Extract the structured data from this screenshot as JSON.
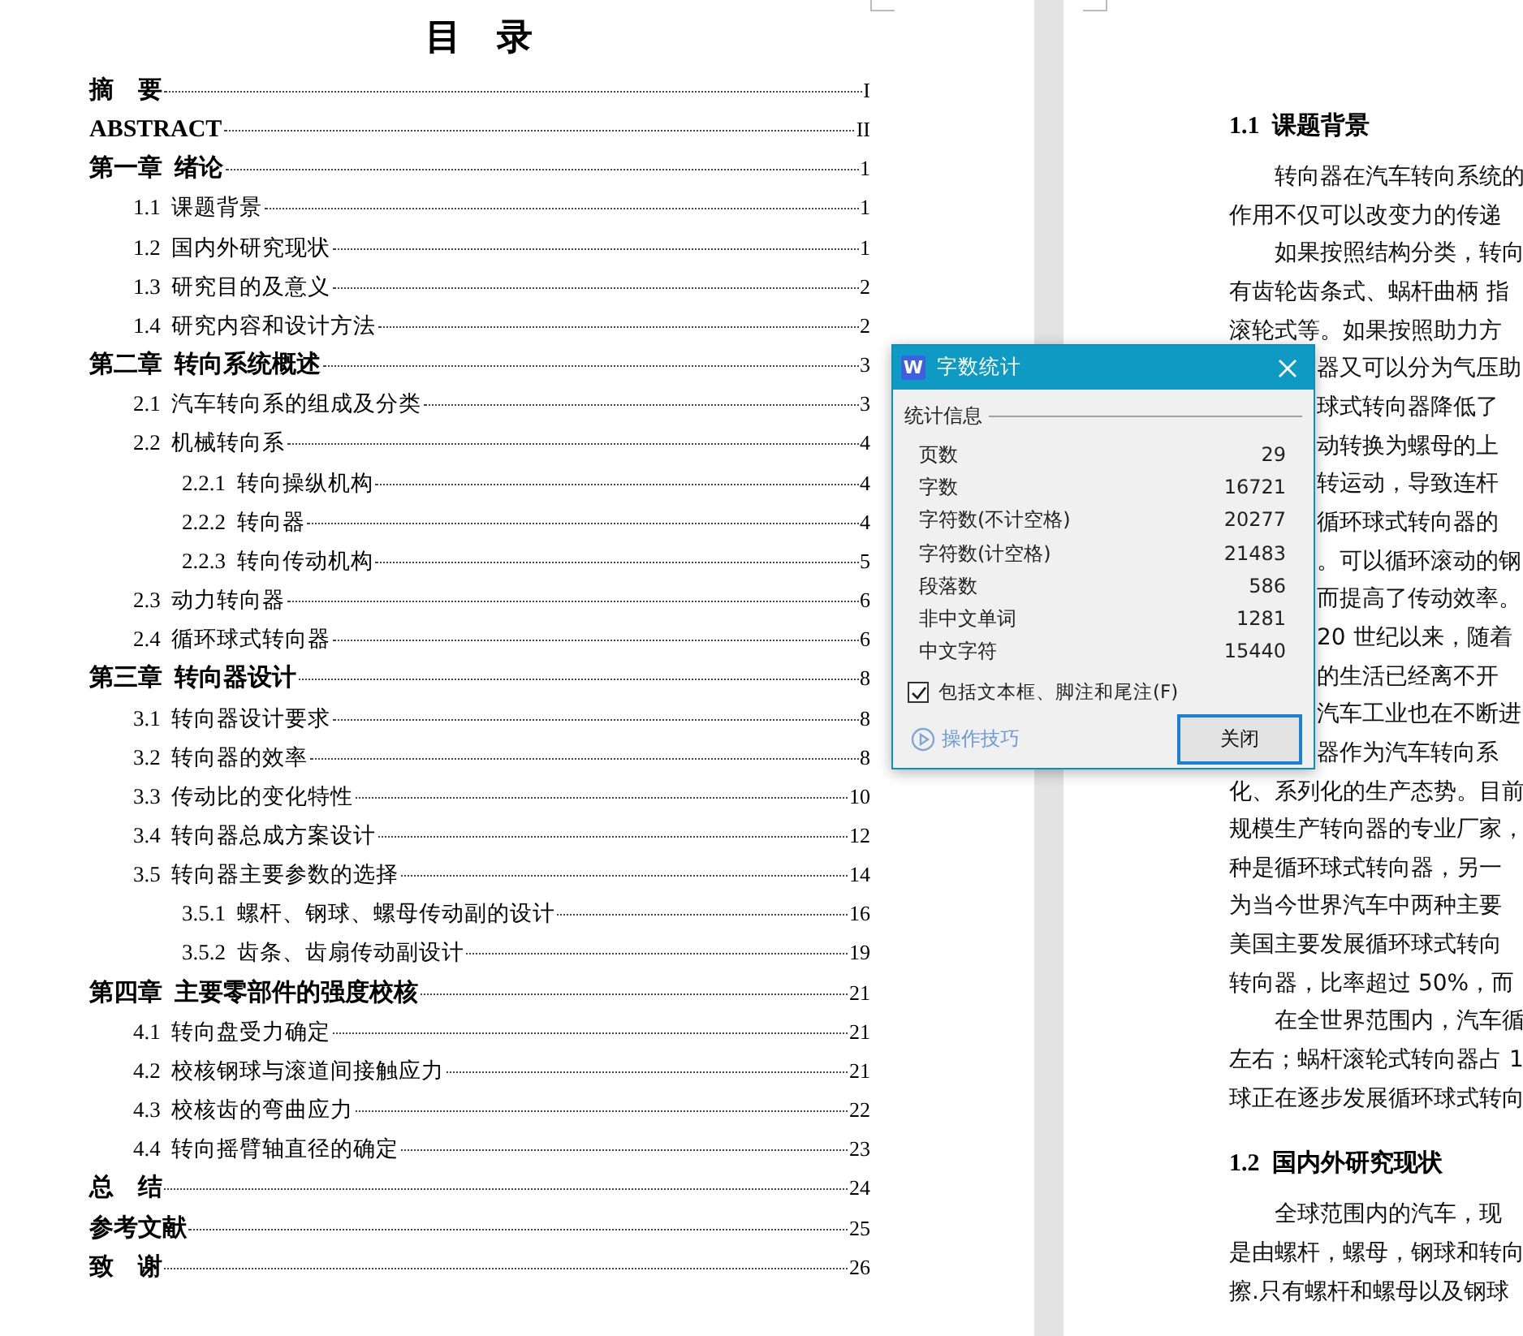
{
  "toc_page": {
    "title": "目　录",
    "entries": [
      {
        "kind": "chapter",
        "text": "摘　要",
        "page": "I"
      },
      {
        "kind": "chapter",
        "text": "ABSTRACT",
        "page": "II"
      },
      {
        "kind": "chapter",
        "text": "第一章  绪论",
        "page": "1",
        "children": [
          {
            "kind": "section",
            "text": "1.1  课题背景",
            "page": "1"
          },
          {
            "kind": "section",
            "text": "1.2  国内外研究现状",
            "page": "1"
          },
          {
            "kind": "section",
            "text": "1.3  研究目的及意义",
            "page": "2"
          },
          {
            "kind": "section",
            "text": "1.4  研究内容和设计方法",
            "page": "2"
          }
        ]
      },
      {
        "kind": "chapter",
        "text": "第二章  转向系统概述",
        "page": "3",
        "children": [
          {
            "kind": "section",
            "text": "2.1  汽车转向系的组成及分类",
            "page": "3"
          },
          {
            "kind": "section",
            "text": "2.2  机械转向系",
            "page": "4",
            "children": [
              {
                "kind": "section",
                "text": "2.2.1  转向操纵机构",
                "page": "4"
              },
              {
                "kind": "section",
                "text": "2.2.2  转向器",
                "page": "4"
              },
              {
                "kind": "section",
                "text": "2.2.3  转向传动机构",
                "page": "5"
              }
            ]
          },
          {
            "kind": "section",
            "text": "2.3  动力转向器",
            "page": "6"
          },
          {
            "kind": "section",
            "text": "2.4  循环球式转向器",
            "page": "6"
          }
        ]
      },
      {
        "kind": "chapter",
        "text": "第三章  转向器设计",
        "page": "8",
        "children": [
          {
            "kind": "section",
            "text": "3.1  转向器设计要求",
            "page": "8"
          },
          {
            "kind": "section",
            "text": "3.2  转向器的效率",
            "page": "8"
          },
          {
            "kind": "section",
            "text": "3.3  传动比的变化特性",
            "page": "10"
          },
          {
            "kind": "section",
            "text": "3.4  转向器总成方案设计",
            "page": "12"
          },
          {
            "kind": "section",
            "text": "3.5  转向器主要参数的选择",
            "page": "14",
            "children": [
              {
                "kind": "section",
                "text": "3.5.1  螺杆、钢球、螺母传动副的设计",
                "page": "16"
              },
              {
                "kind": "section",
                "text": "3.5.2  齿条、齿扇传动副设计",
                "page": "19"
              }
            ]
          }
        ]
      },
      {
        "kind": "chapter",
        "text": "第四章  主要零部件的强度校核",
        "page": "21",
        "children": [
          {
            "kind": "section",
            "text": "4.1  转向盘受力确定",
            "page": "21"
          },
          {
            "kind": "section",
            "text": "4.2  校核钢球与滚道间接触应力",
            "page": "21"
          },
          {
            "kind": "section",
            "text": "4.3  校核齿的弯曲应力",
            "page": "22"
          },
          {
            "kind": "section",
            "text": "4.4  转向摇臂轴直径的确定",
            "page": "23"
          }
        ]
      },
      {
        "kind": "chapter",
        "text": "总　结",
        "page": "24"
      },
      {
        "kind": "chapter",
        "text": "参考文献",
        "page": "25"
      },
      {
        "kind": "chapter",
        "text": "致　谢",
        "page": "26"
      }
    ]
  },
  "body_page": {
    "blocks": [
      {
        "kind": "heading",
        "text": "1.1  课题背景"
      },
      {
        "kind": "first",
        "text": "转向器在汽车转向系统的"
      },
      {
        "kind": "line",
        "text": "作用不仅可以改变力的传递"
      },
      {
        "kind": "first",
        "text": "如果按照结构分类，转向"
      },
      {
        "kind": "line",
        "text": "有齿轮齿条式、蜗杆曲柄 指"
      },
      {
        "kind": "line",
        "text": "滚轮式等。如果按照助力方"
      },
      {
        "kind": "covered",
        "text": "器又可以分为气压助"
      },
      {
        "kind": "covered",
        "text": "球式转向器降低了"
      },
      {
        "kind": "covered",
        "text": "动转换为螺母的上"
      },
      {
        "kind": "covered",
        "text": "转运动，导致连杆"
      },
      {
        "kind": "covered",
        "text": "循环球式转向器的"
      },
      {
        "kind": "covered",
        "text": "。可以循环滚动的钢"
      },
      {
        "kind": "covered",
        "text": "而提高了传动效率。"
      },
      {
        "kind": "covered",
        "text": "20 世纪以来，随着"
      },
      {
        "kind": "covered",
        "text": "的生活已经离不开"
      },
      {
        "kind": "covered",
        "text": "汽车工业也在不断进"
      },
      {
        "kind": "covered",
        "text": "器作为汽车转向系"
      },
      {
        "kind": "line",
        "text": "化、系列化的生产态势。目前"
      },
      {
        "kind": "line",
        "text": "规模生产转向器的专业厂家，"
      },
      {
        "kind": "line",
        "text": "种是循环球式转向器，另一"
      },
      {
        "kind": "line",
        "text": "为当今世界汽车中两种主要"
      },
      {
        "kind": "line",
        "text": "美国主要发展循环球式转向"
      },
      {
        "kind": "line",
        "text": "转向器，比率超过 50%，而"
      },
      {
        "kind": "first",
        "text": "在全世界范围内，汽车循"
      },
      {
        "kind": "line",
        "text": "左右；蜗杆滚轮式转向器占 1"
      },
      {
        "kind": "line",
        "text": "球正在逐步发展循环球式转向"
      },
      {
        "kind": "heading",
        "text": "1.2  国内外研究现状"
      },
      {
        "kind": "first",
        "text": "全球范围内的汽车，现"
      },
      {
        "kind": "line",
        "text": "是由螺杆，螺母，钢球和转向"
      },
      {
        "kind": "line",
        "text": "擦.只有螺杆和螺母以及钢球"
      }
    ]
  },
  "dialog": {
    "app_icon": "W",
    "title": "字数统计",
    "group": "统计信息",
    "stats": [
      {
        "label": "页数",
        "value": "29"
      },
      {
        "label": "字数",
        "value": "16721"
      },
      {
        "label": "字符数(不计空格)",
        "value": "20277"
      },
      {
        "label": "字符数(计空格)",
        "value": "21483"
      },
      {
        "label": "段落数",
        "value": "586"
      },
      {
        "label": "非中文单词",
        "value": "1281"
      },
      {
        "label": "中文字符",
        "value": "15440"
      }
    ],
    "checkbox": {
      "label": "包括文本框、脚注和尾注(F)",
      "checked": true
    },
    "tips_link": "操作技巧",
    "button": "关闭"
  }
}
